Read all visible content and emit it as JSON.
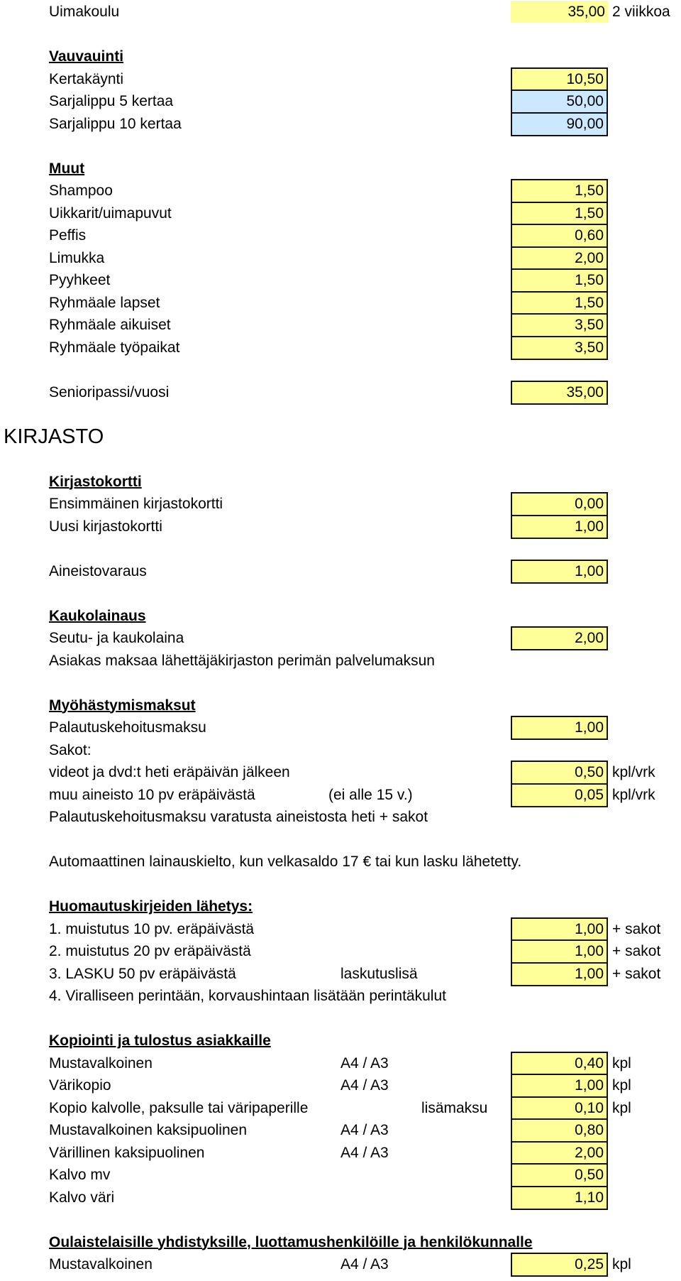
{
  "colors": {
    "yellow": "#ffff99",
    "blue": "#cce8ff",
    "border": "#111111"
  },
  "rows": [
    {
      "label": "Uimakoulu",
      "value": "35,00",
      "fill": "yellow",
      "border": false,
      "unit": "2 viikkoa"
    },
    {
      "label": "Vauvauinti",
      "style": "heading"
    },
    {
      "label": "Kertakäynti",
      "value": "10,50",
      "fill": "yellow",
      "border": true
    },
    {
      "label": "Sarjalippu 5 kertaa",
      "value": "50,00",
      "fill": "blue",
      "border": true
    },
    {
      "label": "Sarjalippu 10 kertaa",
      "value": "90,00",
      "fill": "blue",
      "border": true
    },
    {
      "label": "Muut",
      "style": "heading"
    },
    {
      "label": "Shampoo",
      "value": "1,50",
      "fill": "yellow",
      "border": true
    },
    {
      "label": "Uikkarit/uimapuvut",
      "value": "1,50",
      "fill": "yellow",
      "border": true
    },
    {
      "label": "Peffis",
      "value": "0,60",
      "fill": "yellow",
      "border": true
    },
    {
      "label": "Limukka",
      "value": "2,00",
      "fill": "yellow",
      "border": true
    },
    {
      "label": "Pyyhkeet",
      "value": "1,50",
      "fill": "yellow",
      "border": true
    },
    {
      "label": "Ryhmäale lapset",
      "value": "1,50",
      "fill": "yellow",
      "border": true
    },
    {
      "label": "Ryhmäale aikuiset",
      "value": "3,50",
      "fill": "yellow",
      "border": true
    },
    {
      "label": "Ryhmäale työpaikat",
      "value": "3,50",
      "fill": "yellow",
      "border": true
    },
    {
      "label": "Senioripassi/vuosi",
      "value": "35,00",
      "fill": "yellow",
      "border": true
    },
    {
      "label": "KIRJASTO",
      "style": "title"
    },
    {
      "label": "Kirjastokortti",
      "style": "heading"
    },
    {
      "label": "Ensimmäinen kirjastokortti",
      "value": "0,00",
      "fill": "yellow",
      "border": true
    },
    {
      "label": "Uusi kirjastokortti",
      "value": "1,00",
      "fill": "yellow",
      "border": true
    },
    {
      "label": "Aineistovaraus",
      "value": "1,00",
      "fill": "yellow",
      "border": true
    },
    {
      "label": "Kaukolainaus",
      "style": "heading"
    },
    {
      "label": "Seutu- ja kaukolaina",
      "value": "2,00",
      "fill": "yellow",
      "border": true
    },
    {
      "label": "Asiakas maksaa lähettäjäkirjaston perimän palvelumaksun"
    },
    {
      "label": "Myöhästymismaksut",
      "style": "heading"
    },
    {
      "label": "Palautuskehoitusmaksu",
      "value": "1,00",
      "fill": "yellow",
      "border": true
    },
    {
      "label": "Sakot:"
    },
    {
      "label": "videot ja dvd:t heti eräpäivän jälkeen",
      "value": "0,50",
      "fill": "yellow",
      "border": true,
      "unit": "kpl/vrk"
    },
    {
      "label": "muu aineisto 10 pv eräpäivästä",
      "mid": "(ei alle  15 v.)",
      "value": "0,05",
      "fill": "yellow",
      "border": true,
      "unit": "kpl/vrk"
    },
    {
      "label": "Palautuskehoitusmaksu varatusta aineistosta heti + sakot"
    },
    {
      "label": "Automaattinen lainauskielto, kun velkasaldo 17 € tai kun lasku lähetetty."
    },
    {
      "label": "Huomautuskirjeiden lähetys:",
      "style": "heading"
    },
    {
      "label": "1. muistutus 10 pv. eräpäivästä",
      "value": "1,00",
      "fill": "yellow",
      "border": true,
      "unit": "+ sakot"
    },
    {
      "label": "2. muistutus 20 pv eräpäivästä",
      "value": "1,00",
      "fill": "yellow",
      "border": true,
      "unit": "+ sakot"
    },
    {
      "label": "3. LASKU 50 pv eräpäivästä",
      "mid": "laskutuslisä",
      "value": "1,00",
      "fill": "yellow",
      "border": true,
      "unit": "+ sakot"
    },
    {
      "label": "4. Viralliseen perintään, korvaushintaan lisätään perintäkulut"
    },
    {
      "label": "Kopiointi ja tulostus asiakkaille",
      "style": "heading"
    },
    {
      "label": "Mustavalkoinen",
      "mid": "A4 / A3",
      "value": "0,40",
      "fill": "yellow",
      "border": true,
      "unit": "kpl"
    },
    {
      "label": "Värikopio",
      "mid": "A4 / A3",
      "value": "1,00",
      "fill": "yellow",
      "border": true,
      "unit": "kpl"
    },
    {
      "label": "Kopio kalvolle, paksulle tai väripaperille",
      "mid": "lisämaksu",
      "value": "0,10",
      "fill": "yellow",
      "border": true,
      "unit": "kpl"
    },
    {
      "label": "Mustavalkoinen kaksipuolinen",
      "mid": "A4 / A3",
      "value": "0,80",
      "fill": "yellow",
      "border": true
    },
    {
      "label": "Värillinen kaksipuolinen",
      "mid": "A4 / A3",
      "value": "2,00",
      "fill": "yellow",
      "border": true
    },
    {
      "label": "Kalvo mv",
      "value": "0,50",
      "fill": "yellow",
      "border": true
    },
    {
      "label": "Kalvo väri",
      "value": "1,10",
      "fill": "yellow",
      "border": true
    },
    {
      "label": "Oulaistelaisille yhdistyksille, luottamushenkilöille ja henkilökunnalle",
      "style": "heading"
    },
    {
      "label": "Mustavalkoinen",
      "mid": "A4 / A3",
      "value": "0,25",
      "fill": "yellow",
      "border": true,
      "unit": "kpl"
    }
  ]
}
